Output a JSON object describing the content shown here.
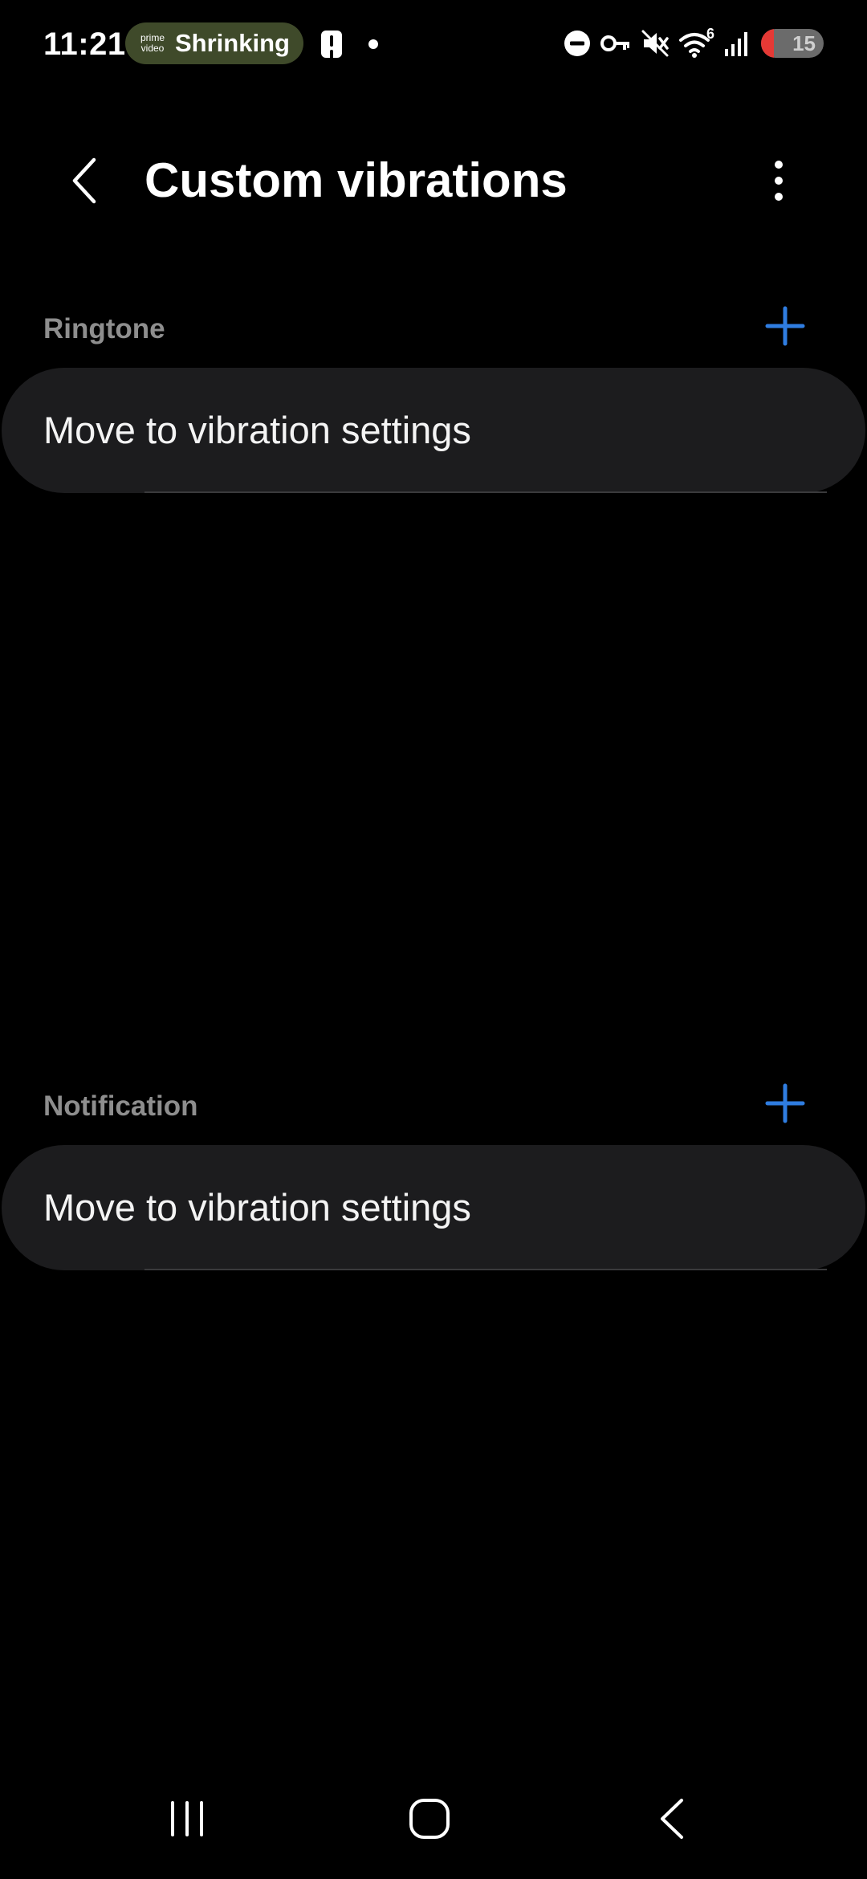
{
  "status_bar": {
    "time": "11:21",
    "media_app": "prime video",
    "media_title": "Shrinking",
    "signal_label": "6",
    "battery_level": "15",
    "icons": [
      "dnd-icon",
      "vpn-key-icon",
      "mute-icon",
      "wifi-icon",
      "signal-icon",
      "battery-icon"
    ]
  },
  "app_bar": {
    "title": "Custom vibrations"
  },
  "sections": [
    {
      "label": "Ringtone",
      "item_label": "Move to vibration settings"
    },
    {
      "label": "Notification",
      "item_label": "Move to vibration settings"
    }
  ],
  "colors": {
    "background": "#000000",
    "card": "#1c1c1e",
    "accent": "#2f7de1",
    "section_label": "#8e8e8e",
    "media_pill": "#3f4a2a"
  }
}
